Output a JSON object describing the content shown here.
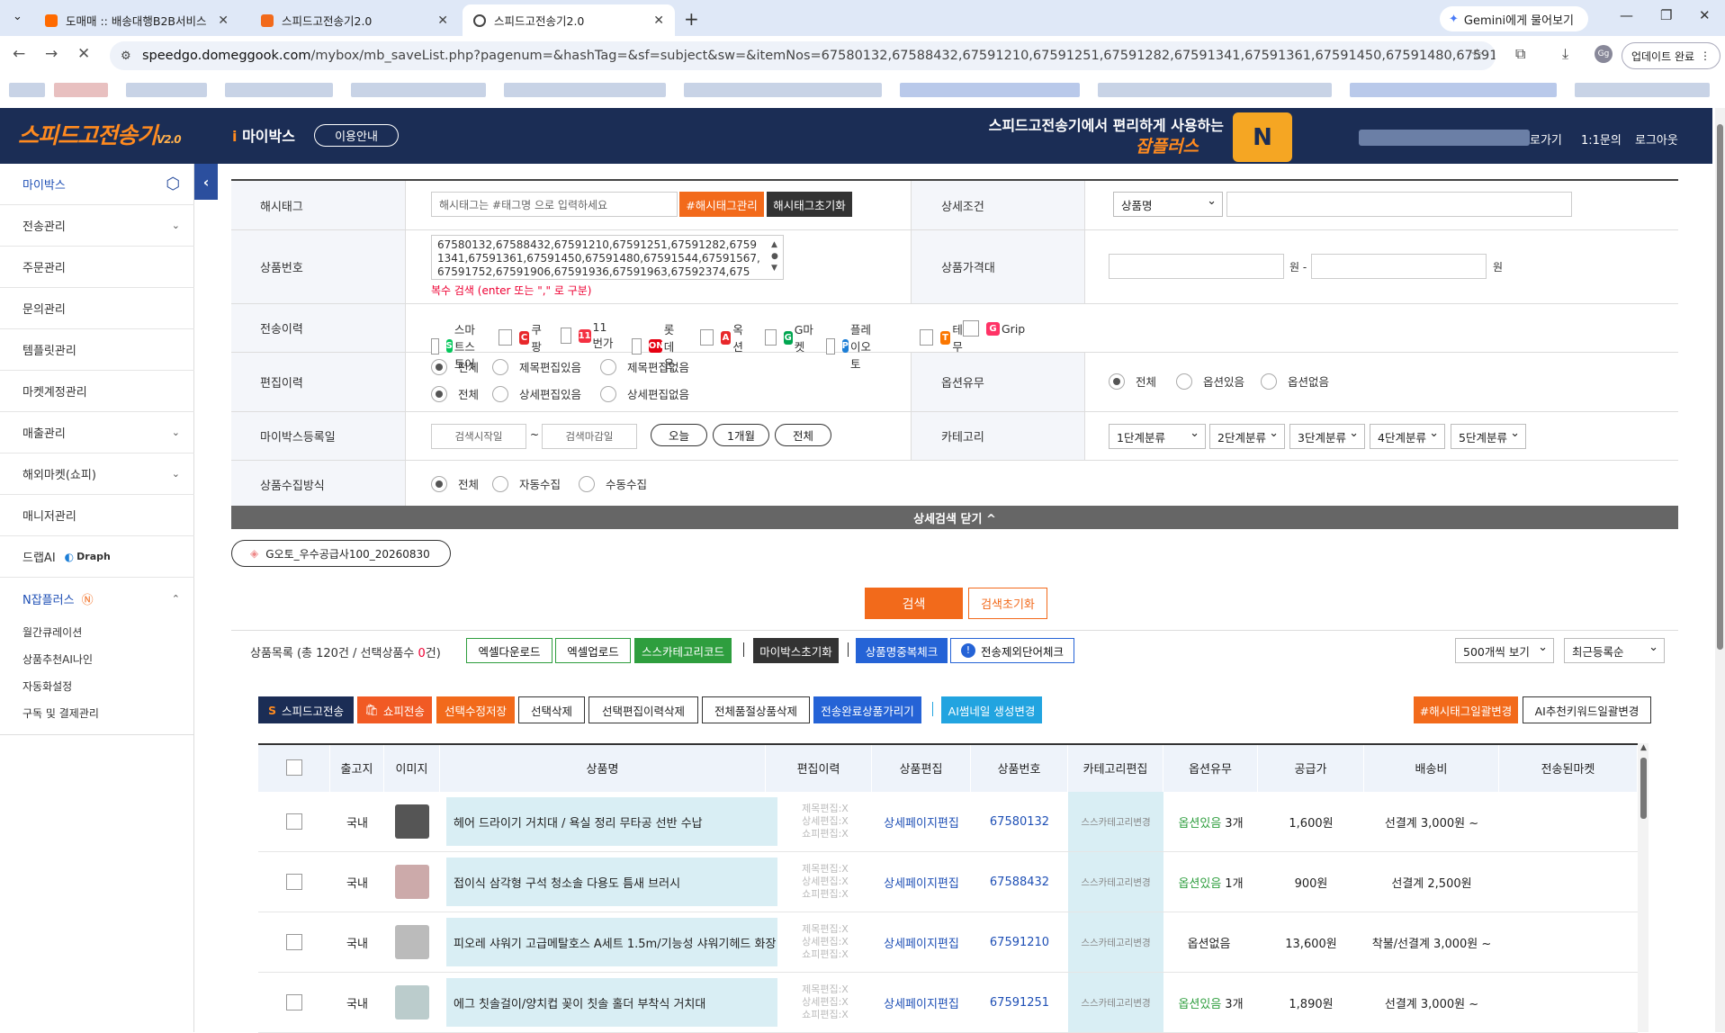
{
  "browser": {
    "tabs": [
      {
        "title": "도매매 :: 배송대행B2B서비스"
      },
      {
        "title": "스피드고전송기2.0"
      },
      {
        "title": "스피드고전송기2.0"
      }
    ],
    "gemini_label": "Gemini에게 물어보기",
    "url_domain": "speedgo.domeggook.com",
    "url_path": "/mybox/mb_saveList.php?pagenum=&hashTag=&sf=subject&sw=&itemNos=67580132,67588432,67591210,67591251,67591282,67591341,67591361,67591450,67591480,67591544,67591567,67591752,6...",
    "update_label": "업데이트 완료",
    "profile": "Gg"
  },
  "header": {
    "logo": "스피드고전송기",
    "logo_version": "V2.0",
    "mybox": "마이박스",
    "guide": "이용안내",
    "promo_line1": "스피드고전송기에서 편리하게 사용하는",
    "promo_line2": "잡플러스",
    "link_go": "로가기",
    "link_qna": "1:1문의",
    "link_logout": "로그아웃"
  },
  "sidebar": {
    "items": [
      {
        "label": "마이박스"
      },
      {
        "label": "전송관리"
      },
      {
        "label": "주문관리"
      },
      {
        "label": "문의관리"
      },
      {
        "label": "템플릿관리"
      },
      {
        "label": "마켓계정관리"
      },
      {
        "label": "매출관리"
      },
      {
        "label": "해외마켓(쇼피)"
      },
      {
        "label": "매니저관리"
      },
      {
        "label": "드랩AI",
        "extra": "Draph"
      },
      {
        "label": "N잡플러스"
      }
    ],
    "subitems": [
      "월간큐레이션",
      "상품추천AI나인",
      "자동화설정",
      "구독 및 결제관리"
    ]
  },
  "form": {
    "hashtag_label": "해시태그",
    "hashtag_placeholder": "해시태그는 #태그명 으로 입력하세요",
    "hashtag_manage": "#해시태그관리",
    "hashtag_reset": "해시태그초기화",
    "detail_label": "상세조건",
    "detail_select": "상품명",
    "itemno_label": "상품번호",
    "itemno_value": "67580132,67588432,67591210,67591251,67591282,67591341,67591361,67591450,67591480,67591544,67591567,67591752,67591906,67591936,67591963,67592374,675",
    "itemno_hint": "복수 검색 (enter 또는 \",\" 로 구분)",
    "price_label": "상품가격대",
    "price_unit": "원 -",
    "price_unit2": "원",
    "history_label": "전송이력",
    "markets": [
      {
        "name": "스마트스토어",
        "badge": "S",
        "color": "#03c75a"
      },
      {
        "name": "쿠팡",
        "badge": "C",
        "color": "#e8282b"
      },
      {
        "name": "11번가",
        "badge": "11",
        "color": "#f43142"
      },
      {
        "name": "롯데온",
        "badge": "ON",
        "color": "#e60012"
      },
      {
        "name": "옥션",
        "badge": "A",
        "color": "#e8282b"
      },
      {
        "name": "G마켓",
        "badge": "G",
        "color": "#00a650"
      },
      {
        "name": "플레이오토",
        "badge": "P",
        "color": "#1c7ed6"
      },
      {
        "name": "테무",
        "badge": "T",
        "color": "#fb7701"
      },
      {
        "name": "Grip",
        "badge": "G",
        "color": "#ff3366"
      }
    ],
    "edit_label": "편집이력",
    "edit_row1": [
      "전체",
      "제목편집있음",
      "제목편집없음"
    ],
    "edit_row2": [
      "전체",
      "상세편집있음",
      "상세편집없음"
    ],
    "option_label": "옵션유무",
    "option_radios": [
      "전체",
      "옵션있음",
      "옵션없음"
    ],
    "regdate_label": "마이박스등록일",
    "date_start": "검색시작일",
    "date_tilde": "~",
    "date_end": "검색마감일",
    "date_btns": [
      "오늘",
      "1개월",
      "전체"
    ],
    "category_label": "카테고리",
    "categories": [
      "1단계분류",
      "2단계분류",
      "3단계분류",
      "4단계분류",
      "5단계분류"
    ],
    "collect_label": "상품수집방식",
    "collect_radios": [
      "전체",
      "자동수집",
      "수동수집"
    ],
    "close_detail": "상세검색 닫기 ^"
  },
  "preset": "G오토_우수공급사100_20260830",
  "search_btn": "검색",
  "reset_btn": "검색초기화",
  "list": {
    "count_prefix": "상품목록 (총 120건 / 선택상품수 ",
    "count_selected": "0",
    "count_suffix": "건)",
    "tools": [
      "엑셀다운로드",
      "엑셀업로드",
      "스스카테고리코드",
      "마이박스초기화",
      "상품명중복체크",
      "전송제외단어체크"
    ],
    "view_count": "500개씩 보기",
    "sort": "최근등록순",
    "actions": [
      "스피드고전송",
      "쇼피전송",
      "선택수정저장",
      "선택삭제",
      "선택편집이력삭제",
      "전체품절상품삭제",
      "전송완료상품가리기",
      "AI썸네일 생성변경"
    ],
    "right_actions": [
      "#해시태그일괄변경",
      "AI추천키워드일괄변경"
    ],
    "columns": [
      "출고지",
      "이미지",
      "상품명",
      "편집이력",
      "상품편집",
      "상품번호",
      "카테고리편집",
      "옵션유무",
      "공급가",
      "배송비",
      "전송된마켓"
    ],
    "edit_history_lines": [
      "제목편집:X",
      "상세편집:X",
      "쇼피편집:X"
    ],
    "detail_edit": "상세페이지편집",
    "cat_change": "스스카테고리변경",
    "rows": [
      {
        "origin": "국내",
        "name": "헤어 드라이기 거치대 / 욕실 정리 무타공 선반 수납",
        "no": "67580132",
        "option": "옵션있음",
        "option_count": "3개",
        "price": "1,600원",
        "ship": "선결계  3,000원 ~"
      },
      {
        "origin": "국내",
        "name": "접이식 삼각형 구석 청소솔 다용도 틈새 브러시",
        "no": "67588432",
        "option": "옵션있음",
        "option_count": "1개",
        "price": "900원",
        "ship": "선결계  2,500원"
      },
      {
        "origin": "국내",
        "name": "피오레 샤워기 고급메탈호스 A세트 1.5m/기능성 샤워기헤드 화장",
        "no": "67591210",
        "option": "옵션없음",
        "option_count": "",
        "price": "13,600원",
        "ship": "착불/선결계  3,000원 ~"
      },
      {
        "origin": "국내",
        "name": "에그 칫솔걸이/양치컵 꽂이 칫솔 홀더 부착식 거치대",
        "no": "67591251",
        "option": "옵션있음",
        "option_count": "3개",
        "price": "1,890원",
        "ship": "선결계  3,000원 ~"
      }
    ]
  }
}
